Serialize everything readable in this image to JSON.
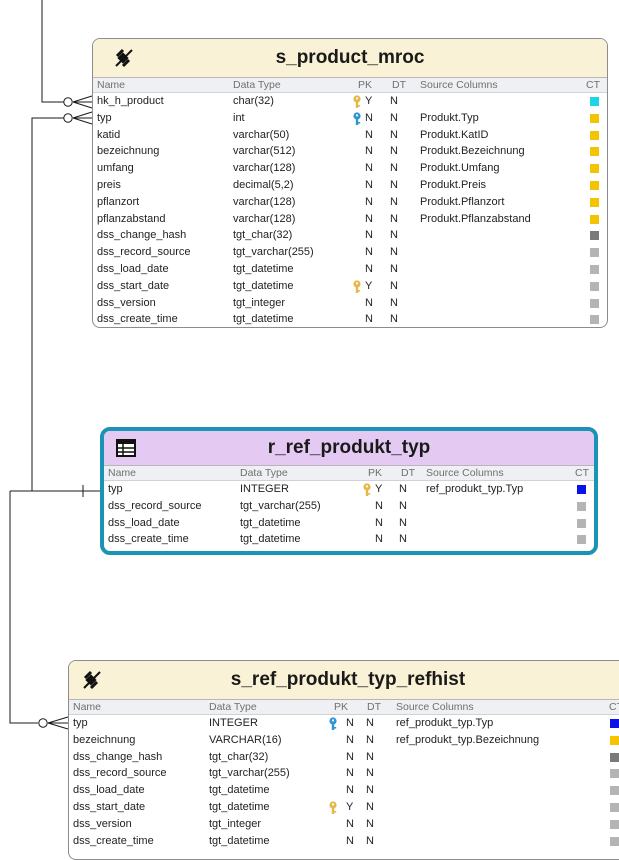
{
  "column_headers": {
    "name": "Name",
    "data_type": "Data Type",
    "pk": "PK",
    "dt": "DT",
    "source": "Source Columns",
    "ct": "CT"
  },
  "colors": {
    "cyan": "#1fd3e7",
    "yellow": "#f5c400",
    "darkgray": "#7a7a7a",
    "lightgray": "#b4b4b4",
    "blue": "#0a12e6",
    "key_gold": "#e6b84a",
    "key_blue": "#2f95d6",
    "purple_header": "#e4caf3",
    "cream_header": "#f9f2d6",
    "teal_border": "#1a93b4"
  },
  "entities": [
    {
      "title": "s_product_mroc",
      "icon": "satellite-icon",
      "rows": [
        {
          "name": "hk_h_product",
          "type": "char(32)",
          "key": "gold",
          "pk": "Y",
          "dt": "N",
          "source": "",
          "ct": "cyan"
        },
        {
          "name": "typ",
          "type": "int",
          "key": "blue",
          "pk": "N",
          "dt": "N",
          "source": "Produkt.Typ",
          "ct": "yellow"
        },
        {
          "name": "katid",
          "type": "varchar(50)",
          "key": "",
          "pk": "N",
          "dt": "N",
          "source": "Produkt.KatID",
          "ct": "yellow"
        },
        {
          "name": "bezeichnung",
          "type": "varchar(512)",
          "key": "",
          "pk": "N",
          "dt": "N",
          "source": "Produkt.Bezeichnung",
          "ct": "yellow"
        },
        {
          "name": "umfang",
          "type": "varchar(128)",
          "key": "",
          "pk": "N",
          "dt": "N",
          "source": "Produkt.Umfang",
          "ct": "yellow"
        },
        {
          "name": "preis",
          "type": "decimal(5,2)",
          "key": "",
          "pk": "N",
          "dt": "N",
          "source": "Produkt.Preis",
          "ct": "yellow"
        },
        {
          "name": "pflanzort",
          "type": "varchar(128)",
          "key": "",
          "pk": "N",
          "dt": "N",
          "source": "Produkt.Pflanzort",
          "ct": "yellow"
        },
        {
          "name": "pflanzabstand",
          "type": "varchar(128)",
          "key": "",
          "pk": "N",
          "dt": "N",
          "source": "Produkt.Pflanzabstand",
          "ct": "yellow"
        },
        {
          "name": "dss_change_hash",
          "type": "tgt_char(32)",
          "key": "",
          "pk": "N",
          "dt": "N",
          "source": "",
          "ct": "darkgray"
        },
        {
          "name": "dss_record_source",
          "type": "tgt_varchar(255)",
          "key": "",
          "pk": "N",
          "dt": "N",
          "source": "",
          "ct": "lightgray"
        },
        {
          "name": "dss_load_date",
          "type": "tgt_datetime",
          "key": "",
          "pk": "N",
          "dt": "N",
          "source": "",
          "ct": "lightgray"
        },
        {
          "name": "dss_start_date",
          "type": "tgt_datetime",
          "key": "gold",
          "pk": "Y",
          "dt": "N",
          "source": "",
          "ct": "lightgray"
        },
        {
          "name": "dss_version",
          "type": "tgt_integer",
          "key": "",
          "pk": "N",
          "dt": "N",
          "source": "",
          "ct": "lightgray"
        },
        {
          "name": "dss_create_time",
          "type": "tgt_datetime",
          "key": "",
          "pk": "N",
          "dt": "N",
          "source": "",
          "ct": "lightgray"
        }
      ]
    },
    {
      "title": "r_ref_produkt_typ",
      "icon": "table-grid-icon",
      "rows": [
        {
          "name": "typ",
          "type": "INTEGER",
          "key": "gold",
          "pk": "Y",
          "dt": "N",
          "source": "ref_produkt_typ.Typ",
          "ct": "blue"
        },
        {
          "name": "dss_record_source",
          "type": "tgt_varchar(255)",
          "key": "",
          "pk": "N",
          "dt": "N",
          "source": "",
          "ct": "lightgray"
        },
        {
          "name": "dss_load_date",
          "type": "tgt_datetime",
          "key": "",
          "pk": "N",
          "dt": "N",
          "source": "",
          "ct": "lightgray"
        },
        {
          "name": "dss_create_time",
          "type": "tgt_datetime",
          "key": "",
          "pk": "N",
          "dt": "N",
          "source": "",
          "ct": "lightgray"
        }
      ]
    },
    {
      "title": "s_ref_produkt_typ_refhist",
      "icon": "satellite-icon",
      "rows": [
        {
          "name": "typ",
          "type": "INTEGER",
          "key": "blue",
          "pk": "N",
          "dt": "N",
          "source": "ref_produkt_typ.Typ",
          "ct": "blue"
        },
        {
          "name": "bezeichnung",
          "type": "VARCHAR(16)",
          "key": "",
          "pk": "N",
          "dt": "N",
          "source": "ref_produkt_typ.Bezeichnung",
          "ct": "yellow"
        },
        {
          "name": "dss_change_hash",
          "type": "tgt_char(32)",
          "key": "",
          "pk": "N",
          "dt": "N",
          "source": "",
          "ct": "darkgray"
        },
        {
          "name": "dss_record_source",
          "type": "tgt_varchar(255)",
          "key": "",
          "pk": "N",
          "dt": "N",
          "source": "",
          "ct": "lightgray"
        },
        {
          "name": "dss_load_date",
          "type": "tgt_datetime",
          "key": "",
          "pk": "N",
          "dt": "N",
          "source": "",
          "ct": "lightgray"
        },
        {
          "name": "dss_start_date",
          "type": "tgt_datetime",
          "key": "gold",
          "pk": "Y",
          "dt": "N",
          "source": "",
          "ct": "lightgray"
        },
        {
          "name": "dss_version",
          "type": "tgt_integer",
          "key": "",
          "pk": "N",
          "dt": "N",
          "source": "",
          "ct": "lightgray"
        },
        {
          "name": "dss_create_time",
          "type": "tgt_datetime",
          "key": "",
          "pk": "N",
          "dt": "N",
          "source": "",
          "ct": "lightgray"
        }
      ]
    }
  ]
}
